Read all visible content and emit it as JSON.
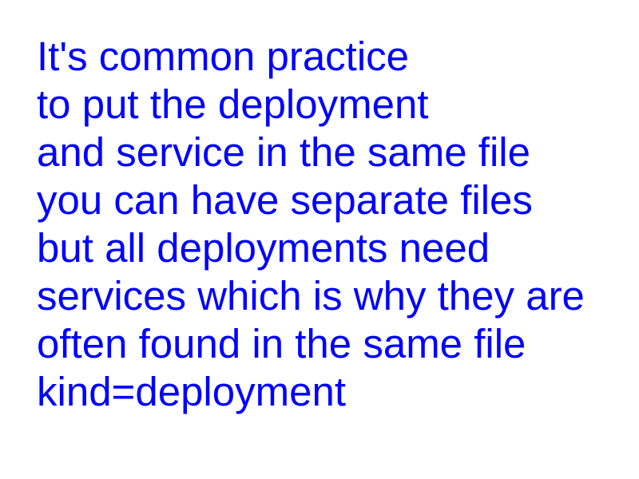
{
  "slide": {
    "text_color": "#0000ff",
    "lines": [
      "It's common practice",
      "to put the deployment",
      "and service in the same file",
      "you can have separate files",
      "but all deployments need",
      "services which is why they are",
      "often found in the same file",
      "kind=deployment"
    ]
  }
}
